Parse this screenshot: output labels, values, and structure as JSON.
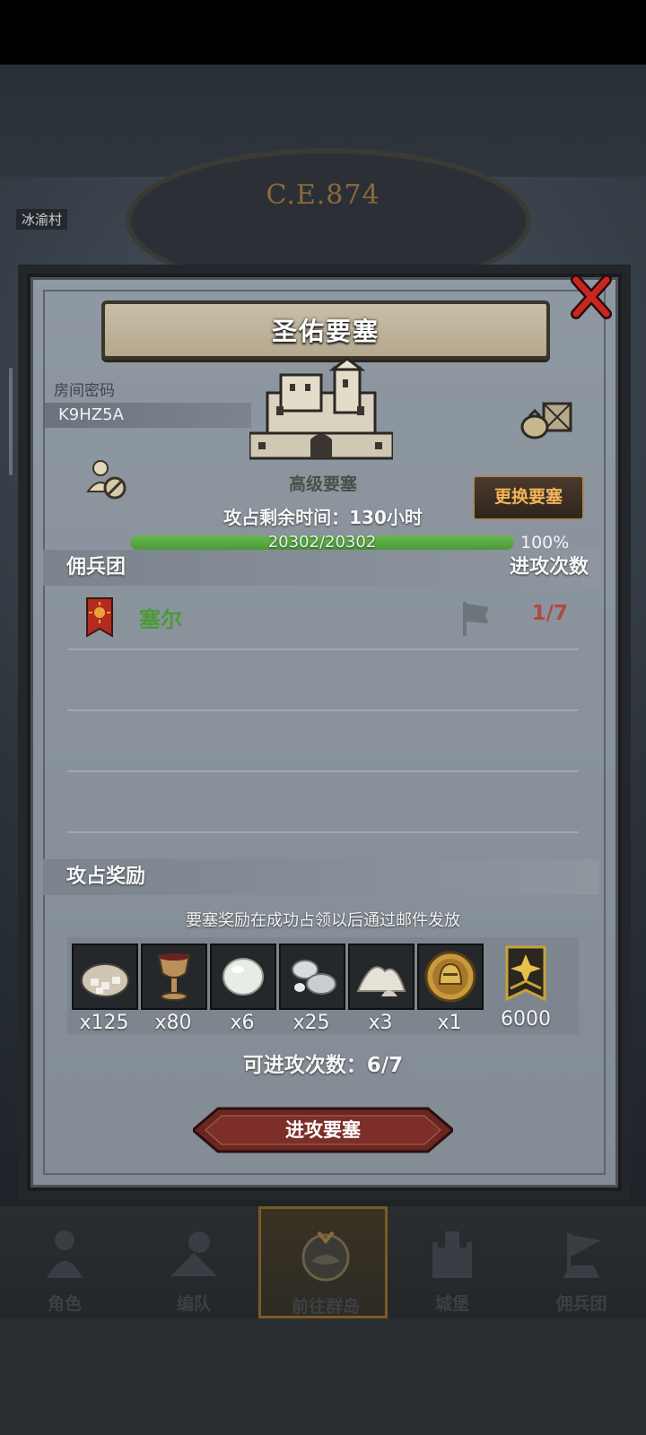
{
  "background": {
    "year": "C.E.874",
    "village_label": "冰渝村"
  },
  "dialog": {
    "title": "圣佑要塞",
    "room_code_label": "房间密码",
    "room_code": "K9HZ5A",
    "fortress_type": "高级要塞",
    "change_button": "更换要塞",
    "remaining_time": "攻占剩余时间：130小时",
    "hp_text": "20302/20302",
    "hp_fraction": 1.0,
    "hp_percent": "100%",
    "mercenary_header": "佣兵团",
    "attack_count_header": "进攻次数",
    "rows": [
      {
        "name": "塞尔",
        "count": "1/7"
      }
    ],
    "rewards_header": "攻占奖励",
    "reward_note": "要塞奖励在成功占领以后通过邮件发放",
    "rewards": [
      {
        "icon": "ore-sack-icon",
        "qty": "x125"
      },
      {
        "icon": "goblet-icon",
        "qty": "x80"
      },
      {
        "icon": "pearl-icon",
        "qty": "x6"
      },
      {
        "icon": "silver-orbs-icon",
        "qty": "x25"
      },
      {
        "icon": "powder-pile-icon",
        "qty": "x3"
      },
      {
        "icon": "helmet-coin-icon",
        "qty": "x1"
      },
      {
        "icon": "rank-badge-icon",
        "qty": "6000"
      }
    ],
    "available_attacks": "可进攻次数：6/7",
    "attack_button": "进攻要塞"
  },
  "nav": {
    "items": [
      {
        "label": "角色",
        "icon": "knight-icon"
      },
      {
        "label": "编队",
        "icon": "formation-icon"
      },
      {
        "label": "前往群岛",
        "icon": "island-icon"
      },
      {
        "label": "城堡",
        "icon": "castle-icon"
      },
      {
        "label": "佣兵团",
        "icon": "mercenary-icon"
      }
    ],
    "active_index": 2
  },
  "colors": {
    "accent_green": "#4b9a3b",
    "count_red": "#b04a44",
    "change_button_text": "#f2b45a",
    "close_red": "#c8261f"
  }
}
